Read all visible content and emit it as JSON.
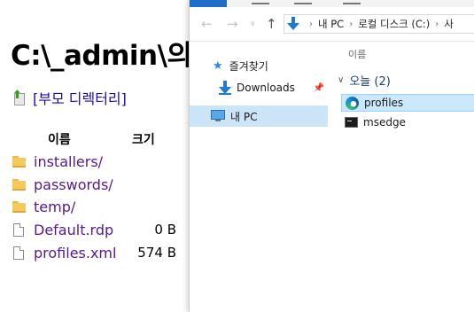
{
  "listing": {
    "title": "C:\\_admin\\의",
    "parent_link": "[부모 디렉터리]",
    "col_name": "이름",
    "col_size": "크기",
    "entries": [
      {
        "name": "installers/",
        "size": ""
      },
      {
        "name": "passwords/",
        "size": ""
      },
      {
        "name": "temp/",
        "size": ""
      },
      {
        "name": "Default.rdp",
        "size": "0 B"
      },
      {
        "name": "profiles.xml",
        "size": "574 B"
      }
    ]
  },
  "explorer": {
    "address": {
      "crumb_1": "내 PC",
      "crumb_2": "로컬 디스크 (C:)",
      "crumb_3": "사"
    },
    "nav": {
      "quick_access": "즐겨찾기",
      "downloads": "Downloads",
      "this_pc": "내 PC"
    },
    "column_name": "이름",
    "group_label": "오늘 (2)",
    "files": [
      {
        "name": "profiles",
        "icon": "edge-icon"
      },
      {
        "name": "msedge",
        "icon": "cmd-icon"
      }
    ]
  },
  "colors": {
    "accent": "#1e6ec8",
    "selection": "#cce8ff",
    "visited_link": "#551a8b",
    "folder": "#f5c95a"
  }
}
